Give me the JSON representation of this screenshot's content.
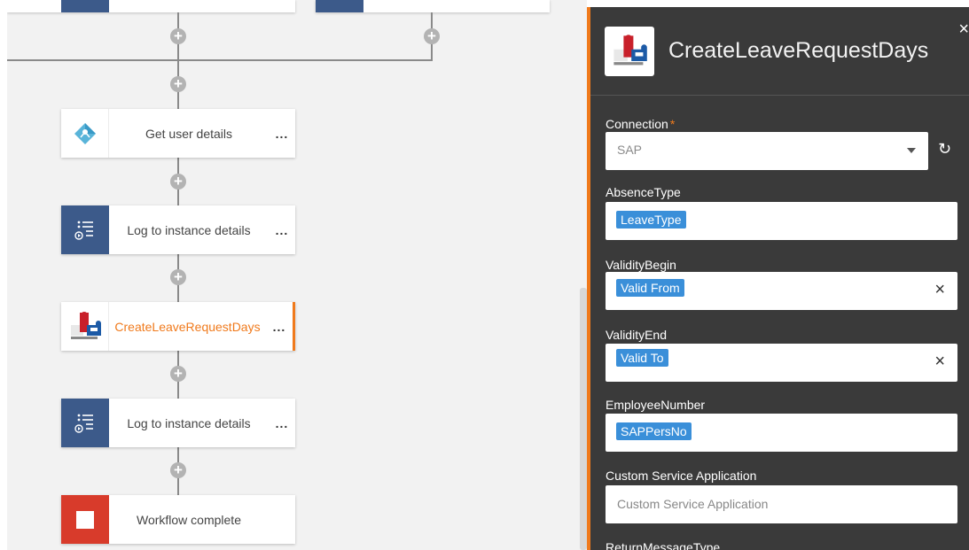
{
  "workflow": {
    "steps": [
      {
        "label": "Get user details",
        "more": "..."
      },
      {
        "label": "Log to instance details",
        "more": "..."
      },
      {
        "label": "CreateLeaveRequestDays",
        "more": "..."
      },
      {
        "label": "Log to instance details",
        "more": "..."
      },
      {
        "label": "Workflow complete"
      }
    ],
    "add_symbol": "+"
  },
  "panel": {
    "title": "CreateLeaveRequestDays",
    "close": "×",
    "connection": {
      "label": "Connection",
      "required": "*",
      "value": "SAP",
      "refresh": "↻"
    },
    "absence_type": {
      "label": "AbsenceType",
      "token": "LeaveType"
    },
    "validity_begin": {
      "label": "ValidityBegin",
      "token": "Valid From",
      "clear": "×"
    },
    "validity_end": {
      "label": "ValidityEnd",
      "token": "Valid To",
      "clear": "×"
    },
    "employee_number": {
      "label": "EmployeeNumber",
      "token": "SAPPersNo"
    },
    "custom_service": {
      "label": "Custom Service Application",
      "placeholder": "Custom Service Application"
    },
    "return_message": {
      "label": "ReturnMessageType"
    }
  },
  "colors": {
    "accent": "#f07a1c",
    "token": "#3a8fd9",
    "panel_bg": "#3a3a3a"
  }
}
